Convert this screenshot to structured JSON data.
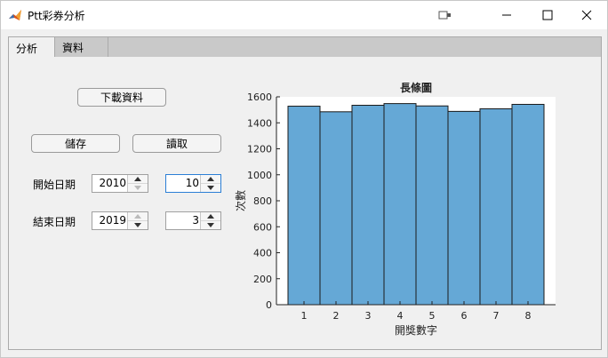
{
  "window": {
    "title": "Ptt彩券分析",
    "controls": [
      "minimize-icon",
      "maximize-icon",
      "close-icon"
    ]
  },
  "tabs": [
    {
      "label": "分析",
      "active": true
    },
    {
      "label": "資料",
      "active": false
    }
  ],
  "buttons": {
    "download": "下載資料",
    "save": "儲存",
    "load": "讀取"
  },
  "start": {
    "label": "開始日期",
    "year": "2010",
    "month": "10"
  },
  "end": {
    "label": "結束日期",
    "year": "2019",
    "month": "3"
  },
  "colors": {
    "bar_fill": "#65a8d6",
    "bar_stroke": "#1a1a1a",
    "focus_border": "#2b7fd6"
  },
  "chart_data": {
    "type": "bar",
    "title": "長條圖",
    "xlabel": "開獎數字",
    "ylabel": "次數",
    "categories": [
      "1",
      "2",
      "3",
      "4",
      "5",
      "6",
      "7",
      "8"
    ],
    "values": [
      1528,
      1485,
      1535,
      1548,
      1530,
      1488,
      1508,
      1542
    ],
    "ylim": [
      0,
      1600
    ],
    "yticks": [
      0,
      200,
      400,
      600,
      800,
      1000,
      1200,
      1400,
      1600
    ],
    "grid": false
  }
}
